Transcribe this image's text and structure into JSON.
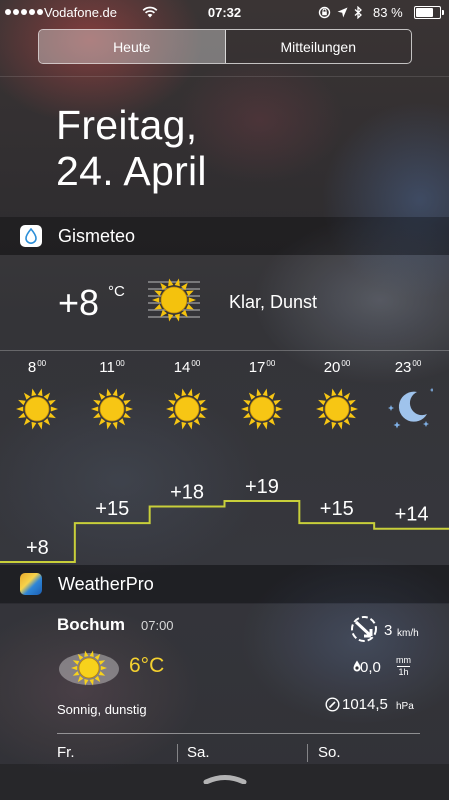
{
  "status_bar": {
    "carrier": "Vodafone.de",
    "time": "07:32",
    "battery_percent": "83 %",
    "battery_level": 0.83,
    "signal_dots": 5
  },
  "tabs": [
    {
      "label": "Heute",
      "active": true
    },
    {
      "label": "Mitteilungen",
      "active": false
    }
  ],
  "date": {
    "weekday": "Freitag,",
    "day_month": "24. April"
  },
  "gismeteo": {
    "title": "Gismeteo",
    "current_temp": "+8",
    "unit": "°C",
    "condition": "Klar, Dunst",
    "current_icon": "sun-haze-icon",
    "hours": [
      {
        "hour": "8",
        "minutes": "00",
        "icon": "sun-icon",
        "temp": "+8",
        "value": 8
      },
      {
        "hour": "11",
        "minutes": "00",
        "icon": "sun-icon",
        "temp": "+15",
        "value": 15
      },
      {
        "hour": "14",
        "minutes": "00",
        "icon": "sun-icon",
        "temp": "+18",
        "value": 18
      },
      {
        "hour": "17",
        "minutes": "00",
        "icon": "sun-icon",
        "temp": "+19",
        "value": 19
      },
      {
        "hour": "20",
        "minutes": "00",
        "icon": "sun-icon",
        "temp": "+15",
        "value": 15
      },
      {
        "hour": "23",
        "minutes": "00",
        "icon": "moon-stars-icon",
        "temp": "+14",
        "value": 14
      }
    ],
    "line_color": "#c8cf3a"
  },
  "weatherpro": {
    "title": "WeatherPro",
    "city": "Bochum",
    "time": "07:00",
    "temp": "6°C",
    "temp_color": "#f5d12f",
    "description": "Sonnig, dunstig",
    "wind_value": "3",
    "wind_unit": "km/h",
    "rain_value": "0,0",
    "rain_unit_top": "mm",
    "rain_unit_bottom": "1h",
    "pressure_value": "1014,5",
    "pressure_unit": "hPa",
    "days": [
      "Fr.",
      "Sa.",
      "So."
    ]
  }
}
